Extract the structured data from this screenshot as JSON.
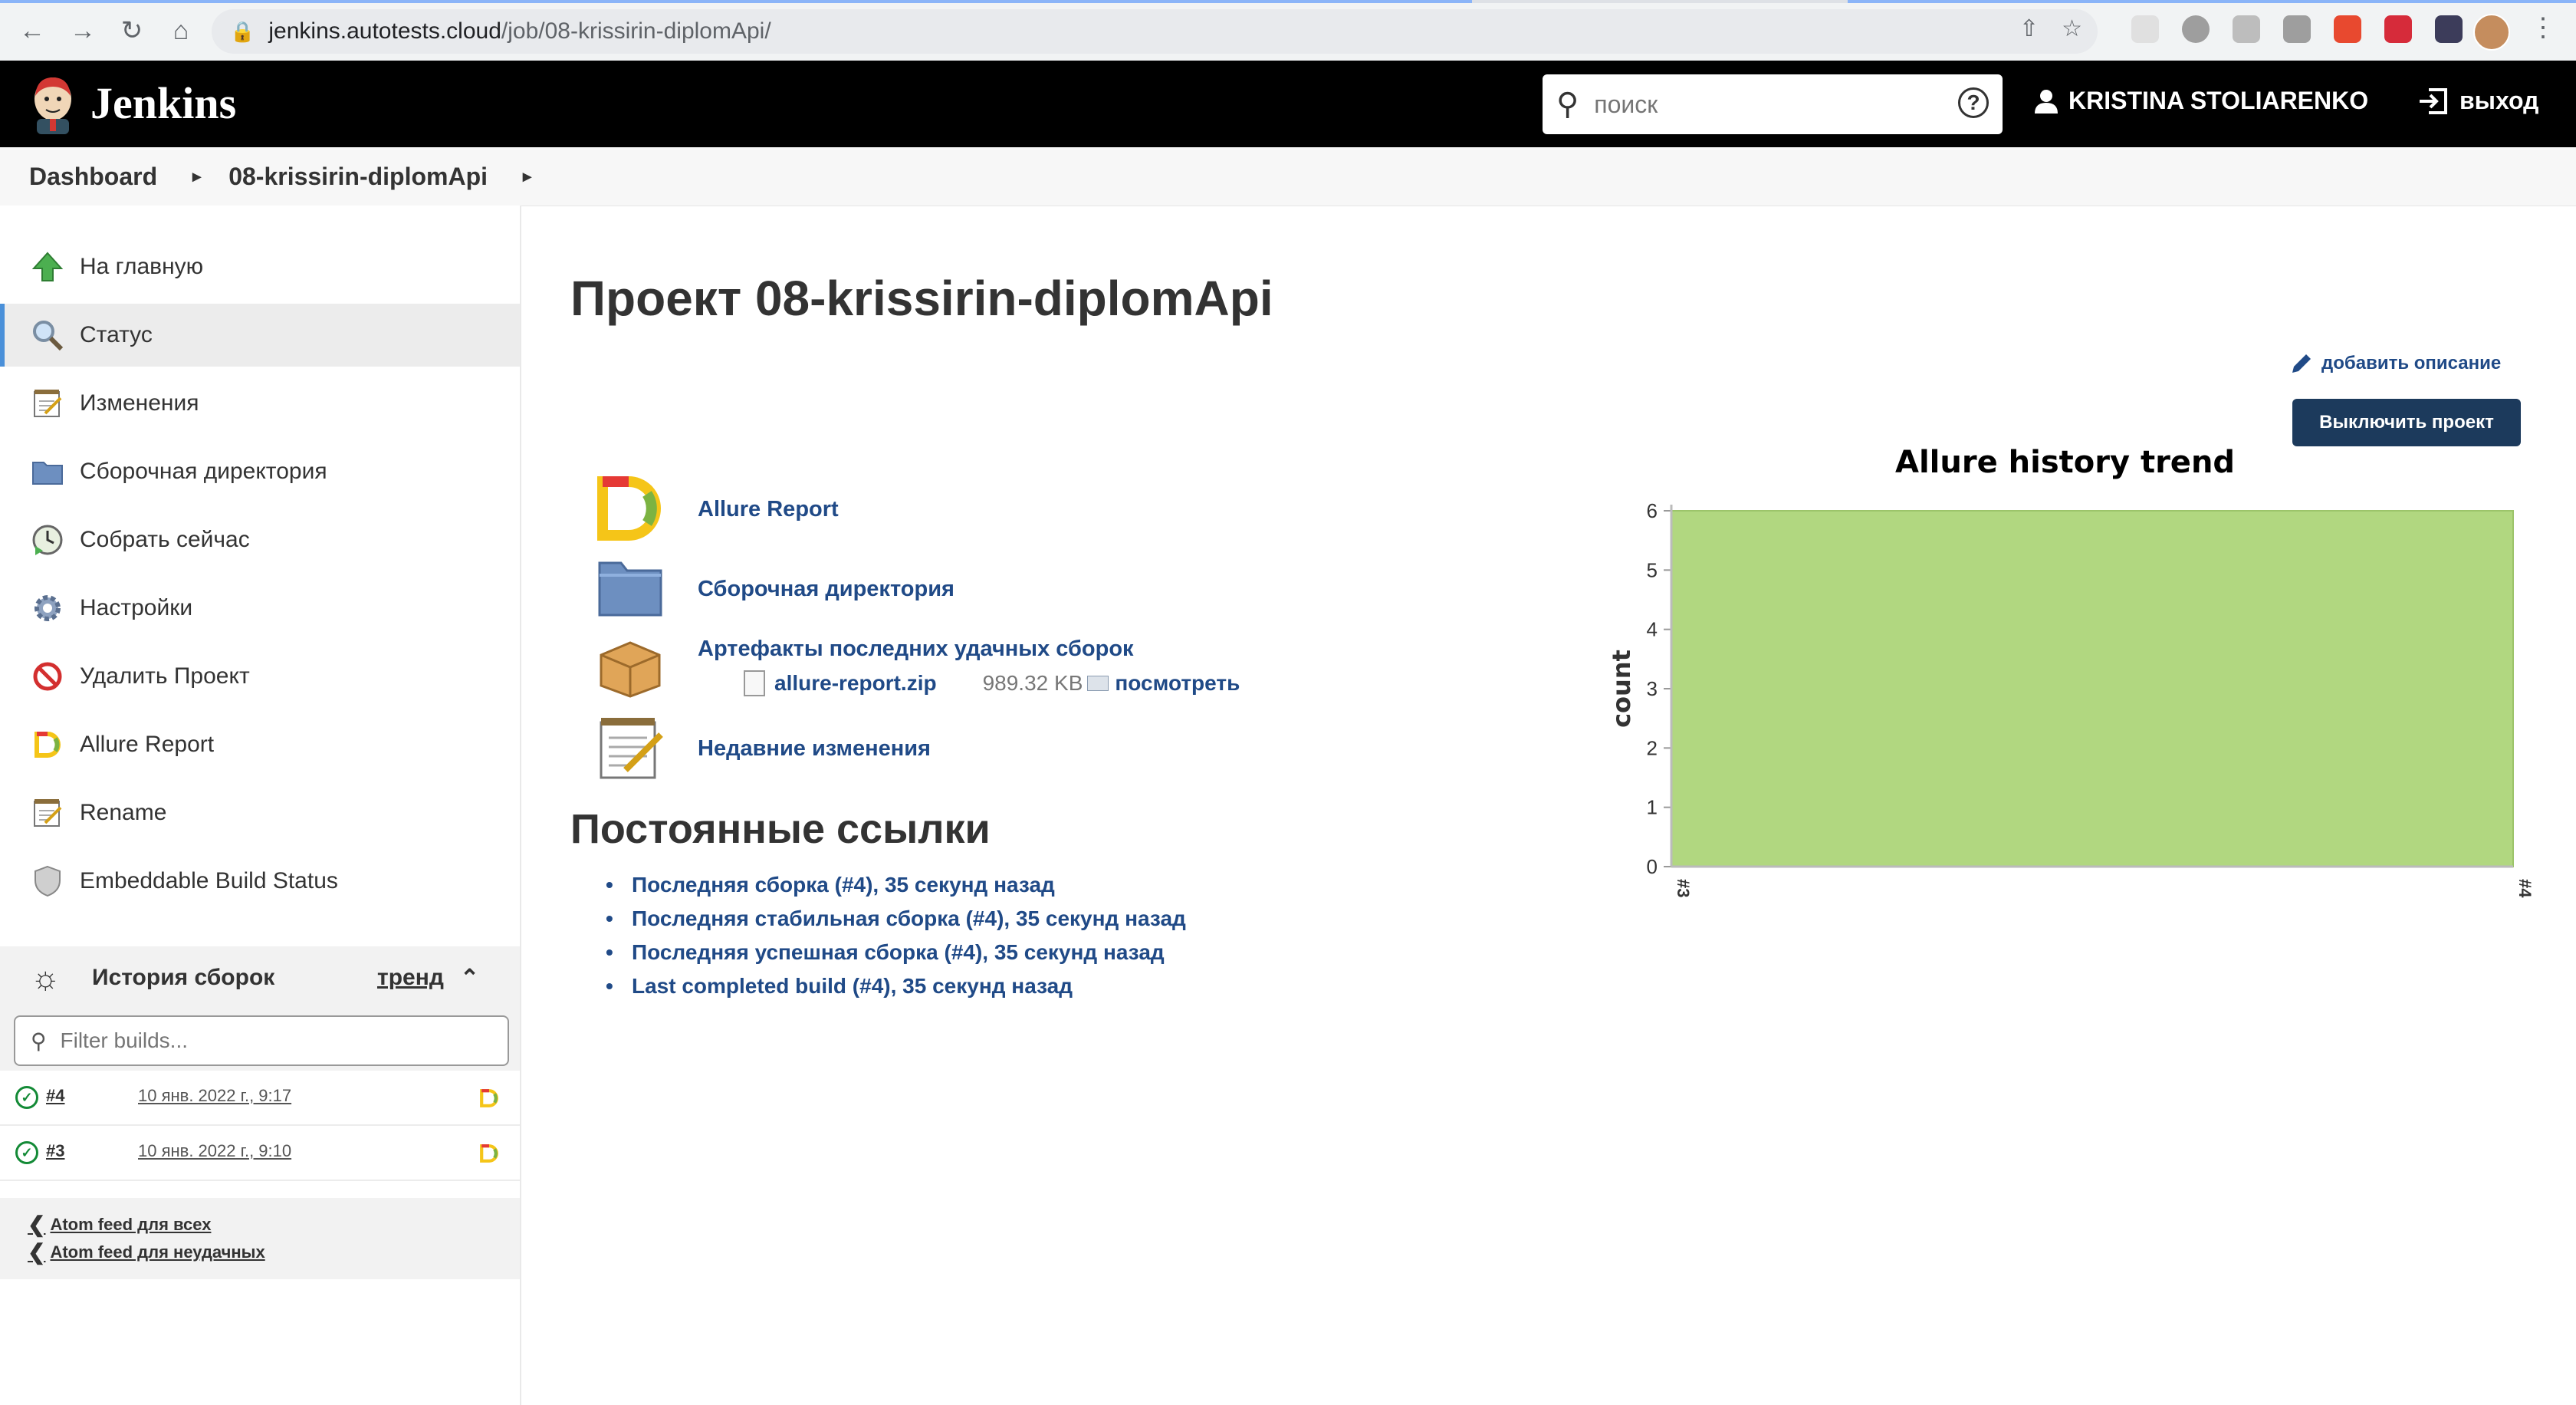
{
  "browser": {
    "url_host": "jenkins.autotests.cloud",
    "url_path": "/job/08-krissirin-diplomApi/"
  },
  "header": {
    "app_title": "Jenkins",
    "search_placeholder": "поиск",
    "user_name": "KRISTINA STOLIARENKO",
    "logout_label": "выход"
  },
  "breadcrumbs": [
    "Dashboard",
    "08-krissirin-diplomApi"
  ],
  "sidebar": {
    "items": [
      {
        "label": "На главную",
        "icon": "up-arrow-icon"
      },
      {
        "label": "Статус",
        "icon": "magnifier-icon"
      },
      {
        "label": "Изменения",
        "icon": "notepad-icon"
      },
      {
        "label": "Сборочная директория",
        "icon": "folder-icon"
      },
      {
        "label": "Собрать сейчас",
        "icon": "clock-play-icon"
      },
      {
        "label": "Настройки",
        "icon": "gear-icon"
      },
      {
        "label": "Удалить Проект",
        "icon": "no-entry-icon"
      },
      {
        "label": "Allure Report",
        "icon": "allure-icon"
      },
      {
        "label": "Rename",
        "icon": "notepad-icon"
      },
      {
        "label": "Embeddable Build Status",
        "icon": "shield-icon"
      }
    ],
    "history": {
      "title": "История сборок",
      "trend_label": "тренд",
      "filter_placeholder": "Filter builds...",
      "builds": [
        {
          "number": "#4",
          "date": "10 янв. 2022 г., 9:17"
        },
        {
          "number": "#3",
          "date": "10 янв. 2022 г., 9:10"
        }
      ],
      "feeds": [
        "Atom feed для всех",
        "Atom feed для неудачных"
      ]
    }
  },
  "main": {
    "title": "Проект 08-krissirin-diplomApi",
    "add_description": "добавить описание",
    "disable_button": "Выключить проект",
    "links": {
      "allure": "Allure Report",
      "workspace": "Сборочная директория",
      "artifacts": "Артефакты последних удачных сборок",
      "recent_changes": "Недавние изменения"
    },
    "artifact": {
      "file": "allure-report.zip",
      "size": "989.32 KB",
      "view": "посмотреть"
    },
    "permalinks_title": "Постоянные ссылки",
    "permalinks": [
      "Последняя сборка (#4), 35 секунд назад",
      "Последняя стабильная сборка (#4), 35 секунд назад",
      "Последняя успешная сборка (#4), 35 секунд назад",
      "Last completed build (#4), 35 секунд назад"
    ]
  },
  "chart_data": {
    "type": "area",
    "title": "Allure history trend",
    "xlabel": "",
    "ylabel": "count",
    "categories": [
      "#3",
      "#4"
    ],
    "series": [
      {
        "values": [
          6,
          6
        ],
        "color": "#b1d780"
      }
    ],
    "ylim": [
      0,
      6
    ],
    "yticks": [
      0,
      1,
      2,
      3,
      4,
      5,
      6
    ],
    "grid": true
  },
  "colors": {
    "link": "#204a87",
    "header_bg": "#000000",
    "button_bg": "#1c3a5c",
    "success": "#138a36"
  }
}
